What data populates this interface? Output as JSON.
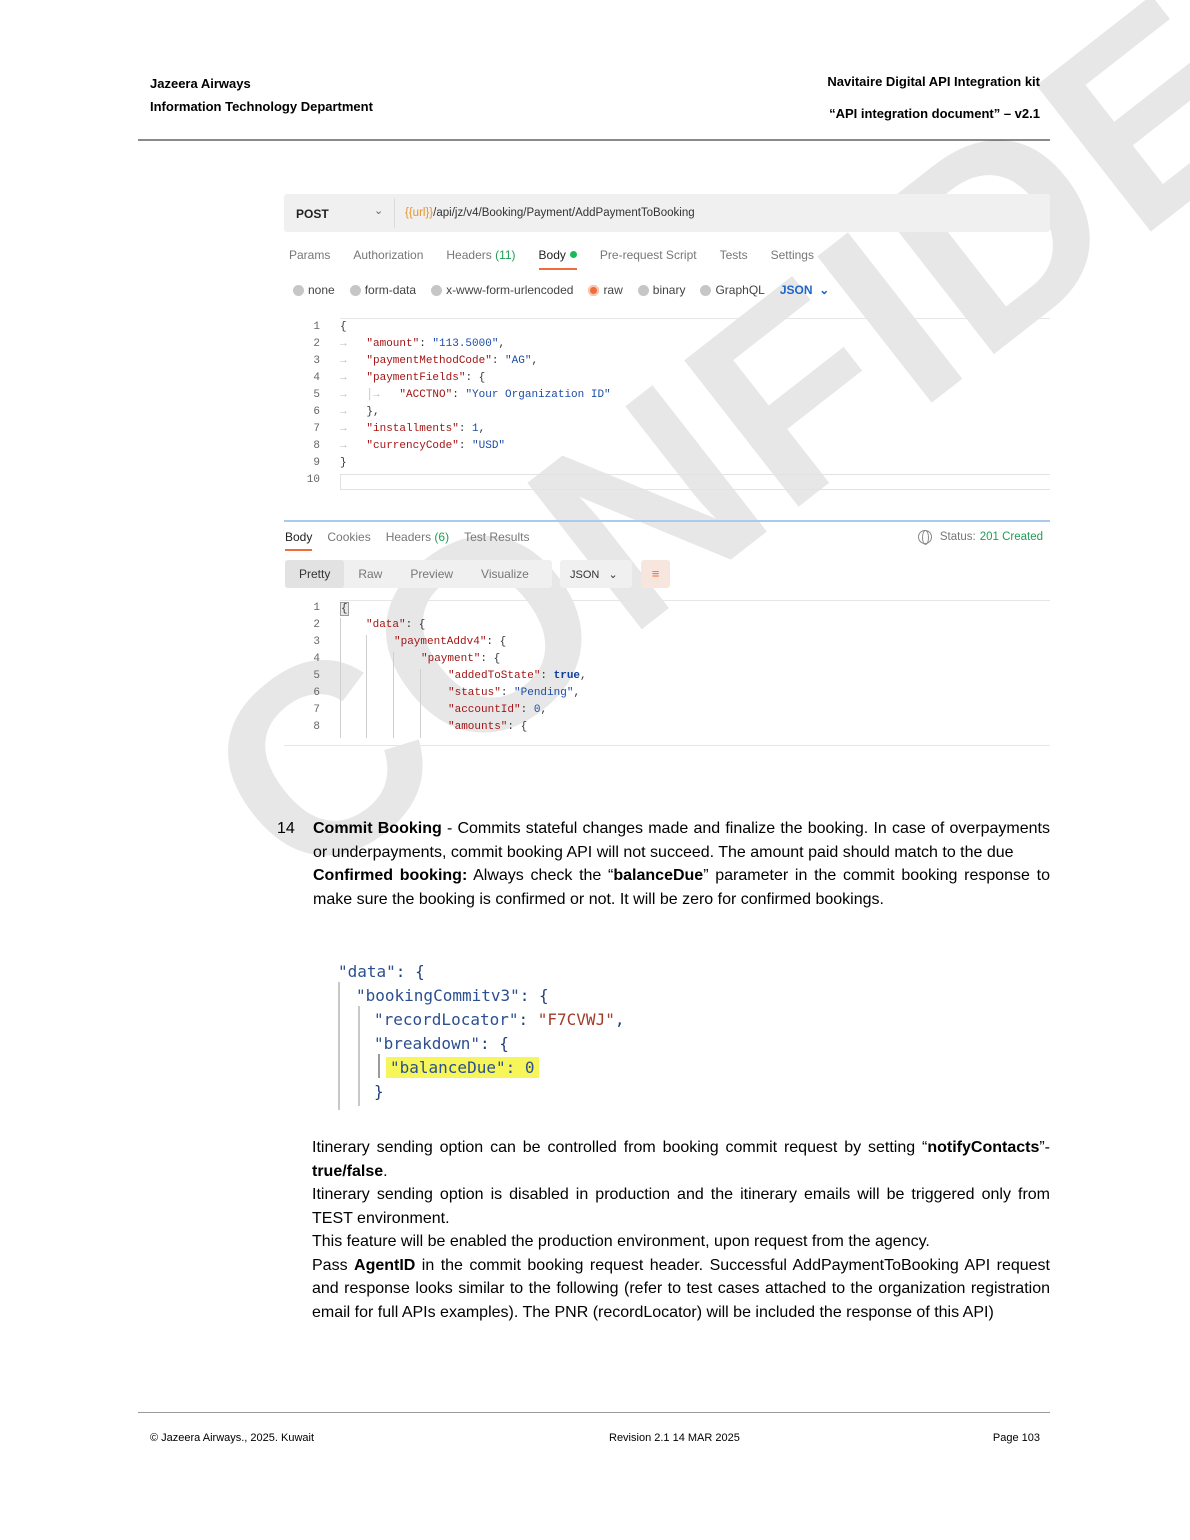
{
  "header": {
    "org_name": "Jazeera Airways",
    "dept": "Information Technology Department",
    "kit_title": "Navitaire Digital API Integration kit",
    "doc_title": "“API integration document” – v2.1"
  },
  "watermark": "CONFIDE",
  "postman": {
    "method": "POST",
    "url_var": "{{url}}",
    "url_path": "/api/jz/v4/Booking/Payment/AddPaymentToBooking",
    "request_tabs": {
      "params": "Params",
      "authorization": "Authorization",
      "headers": "Headers",
      "headers_count": "(11)",
      "body": "Body",
      "prerequest": "Pre-request Script",
      "tests": "Tests",
      "settings": "Settings"
    },
    "body_types": {
      "none": "none",
      "form_data": "form-data",
      "urlencoded": "x-www-form-urlencoded",
      "raw": "raw",
      "binary": "binary",
      "graphql": "GraphQL",
      "json": "JSON",
      "chevron": "⌄"
    },
    "request_body": {
      "line_numbers": [
        "1",
        "2",
        "3",
        "4",
        "5",
        "6",
        "7",
        "8",
        "9",
        "10"
      ],
      "l1": "{",
      "amount_key": "\"amount\"",
      "amount_val": "\"113.5000\"",
      "pmc_key": "\"paymentMethodCode\"",
      "pmc_val": "\"AG\"",
      "pf_key": "\"paymentFields\"",
      "pf_open": ": {",
      "acct_key": "\"ACCTNO\"",
      "acct_val": "\"Your Organization ID\"",
      "pf_close": "},",
      "inst_key": "\"installments\"",
      "inst_val": "1",
      "cur_key": "\"currencyCode\"",
      "cur_val": "\"USD\"",
      "l9": "}"
    },
    "response_tabs": {
      "body": "Body",
      "cookies": "Cookies",
      "headers": "Headers",
      "headers_count": "(6)",
      "test_results": "Test Results"
    },
    "status_label": "Status:",
    "status_value": "201 Created",
    "view_tabs": {
      "pretty": "Pretty",
      "raw": "Raw",
      "preview": "Preview",
      "visualize": "Visualize"
    },
    "response_format": "JSON",
    "response_body": {
      "line_numbers": [
        "1",
        "2",
        "3",
        "4",
        "5",
        "6",
        "7",
        "8"
      ],
      "l1": "{",
      "data_key": "\"data\"",
      "pa_key": "\"paymentAddv4\"",
      "pay_key": "\"payment\"",
      "ats_key": "\"addedToState\"",
      "ats_val": "true",
      "status_key": "\"status\"",
      "status_val": "\"Pending\"",
      "acc_key": "\"accountId\"",
      "acc_val": "0",
      "amounts_key": "\"amounts\"",
      "open": ": {"
    }
  },
  "item14": {
    "number": "14",
    "title": "Commit Booking",
    "desc": " - Commits stateful changes made and finalize the booking. In case of overpayments or underpayments, commit booking API will not succeed. The amount paid should match to the due",
    "confirmed_label": "Confirmed booking:",
    "confirmed_pre": " Always check the “",
    "balance_param": "balanceDue",
    "confirmed_post": "” parameter in the commit booking response to make sure the booking is confirmed or not. It will be zero for confirmed bookings."
  },
  "snippet": {
    "data_key": "\"data\"",
    "bc_key": "\"bookingCommitv3\"",
    "rl_key": "\"recordLocator\"",
    "rl_val": "\"F7CVWJ\"",
    "bd_key": "\"breakdown\"",
    "bal_text": "\"balanceDue\": 0",
    "open": ": {",
    "close": "}"
  },
  "body2": {
    "itin_pre": "Itinerary sending option can be controlled from booking commit request by setting “",
    "notify": "notifyContacts",
    "itin_mid": "”- ",
    "truefalse": "true/false",
    "itin_end": ".",
    "p2": "Itinerary sending option is disabled in production and the itinerary emails will be triggered only from TEST environment.",
    "p3": "This feature will be enabled the production environment, upon request from the agency.",
    "p4_pre": "Pass ",
    "agentid": "AgentID",
    "p4_post": " in the commit booking request header. Successful AddPaymentToBooking API request and response looks similar to the following (refer to test cases attached to the organization registration email for full APIs examples). The PNR (recordLocator) will be included the response of this API)"
  },
  "footer": {
    "copyright": "© Jazeera Airways., 2025. Kuwait",
    "revision": "Revision 2.1  14 MAR 2025",
    "page": "Page 103"
  }
}
